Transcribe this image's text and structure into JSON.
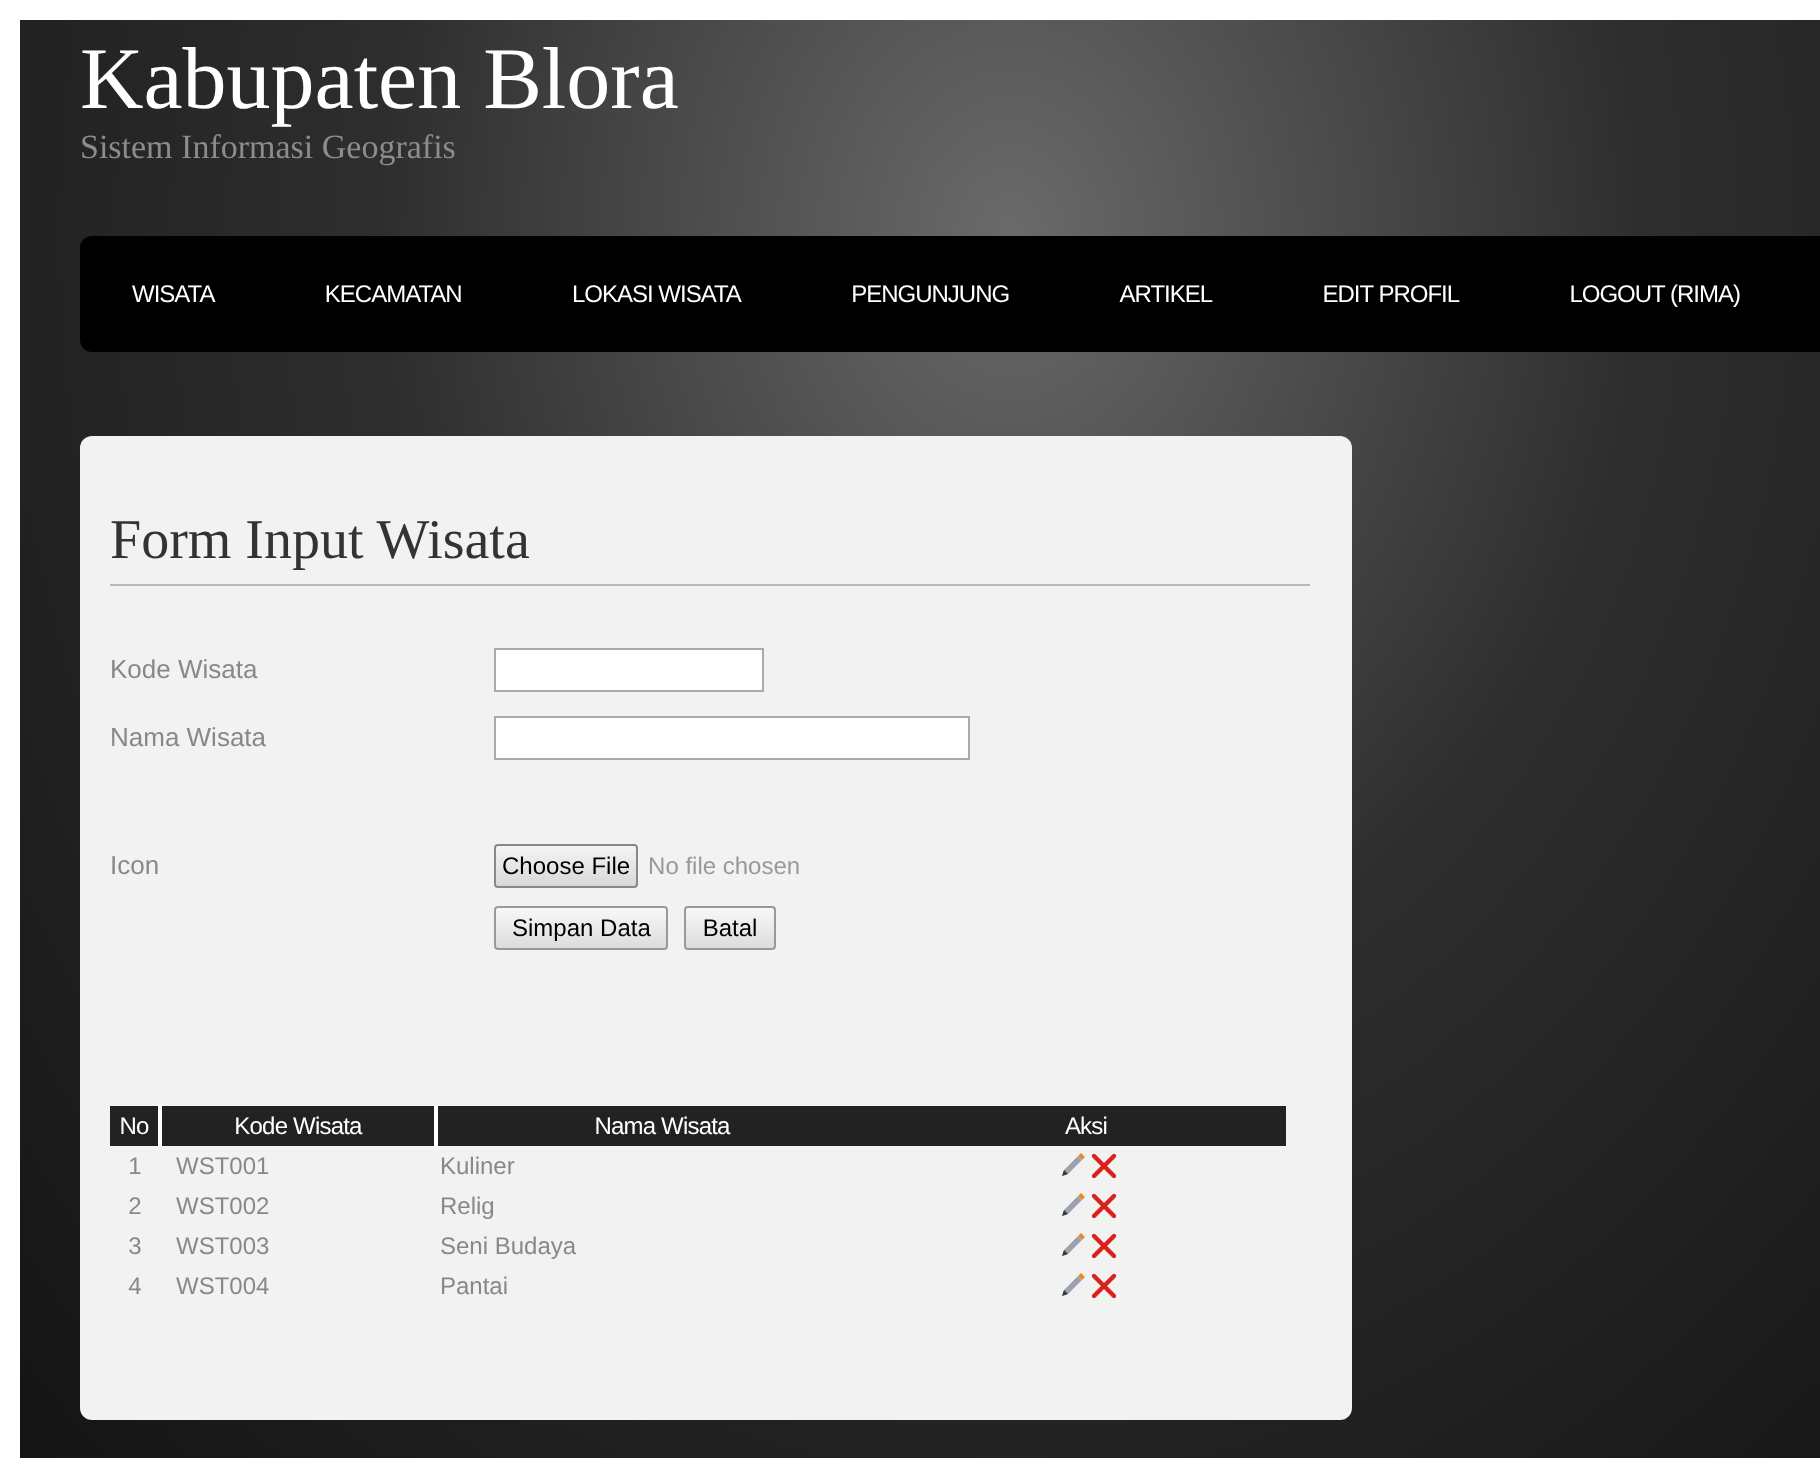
{
  "header": {
    "title": "Kabupaten Blora",
    "subtitle": "Sistem Informasi Geografis"
  },
  "nav": [
    {
      "label": "WISATA"
    },
    {
      "label": "KECAMATAN"
    },
    {
      "label": "LOKASI WISATA"
    },
    {
      "label": "PENGUNJUNG"
    },
    {
      "label": "ARTIKEL"
    },
    {
      "label": "EDIT PROFIL"
    },
    {
      "label": "LOGOUT (RIMA)"
    }
  ],
  "form": {
    "title": "Form Input Wisata",
    "fields": [
      {
        "label": "Kode Wisata",
        "kind": "short"
      },
      {
        "label": "Nama Wisata",
        "kind": "long"
      },
      {
        "label": "Icon",
        "kind": "file",
        "button": "Choose File",
        "status": "No file chosen"
      }
    ],
    "buttons": [
      "Simpan Data",
      "Batal"
    ]
  },
  "table": {
    "columns": [
      "No",
      "Kode Wisata",
      "Nama Wisata",
      "Aksi"
    ],
    "rows": [
      {
        "no": "1",
        "kode": "WST001",
        "nama": "Kuliner"
      },
      {
        "no": "2",
        "kode": "WST002",
        "nama": "Relig"
      },
      {
        "no": "3",
        "kode": "WST003",
        "nama": "Seni Budaya"
      },
      {
        "no": "4",
        "kode": "WST004",
        "nama": "Pantai"
      }
    ]
  }
}
